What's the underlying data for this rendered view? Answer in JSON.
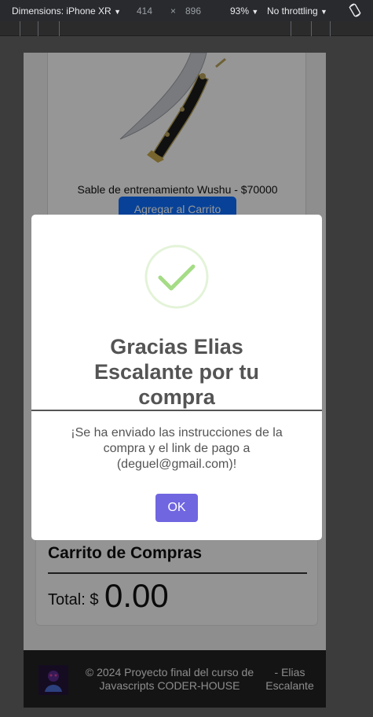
{
  "devtools": {
    "dimensions_label": "Dimensions: iPhone XR",
    "width": "414",
    "separator": "×",
    "height": "896",
    "zoom": "93%",
    "throttling": "No throttling",
    "caret": "▼",
    "rotate_icon": "rotate-icon"
  },
  "product": {
    "title": "Sable de entrenamiento Wushu - $70000",
    "add_button": "Agregar al Carrito",
    "image_icon": "sword-image"
  },
  "cart": {
    "title": "Carrito de Compras",
    "total_label": "Total: $",
    "total_value": "0.00"
  },
  "footer": {
    "text": "© 2024 Proyecto final del curso de Javascripts CODER-HOUSE",
    "author": "- Elias Escalante",
    "logo_icon": "logo-icon"
  },
  "modal": {
    "icon": "success-check-icon",
    "title": "Gracias Elias Escalante por tu compra",
    "text": "¡Se ha enviado las instrucciones de la compra y el link de pago a (deguel@gmail.com)!",
    "ok_button": "OK",
    "accent_color": "#7066e0",
    "success_color": "#a5dc86"
  }
}
